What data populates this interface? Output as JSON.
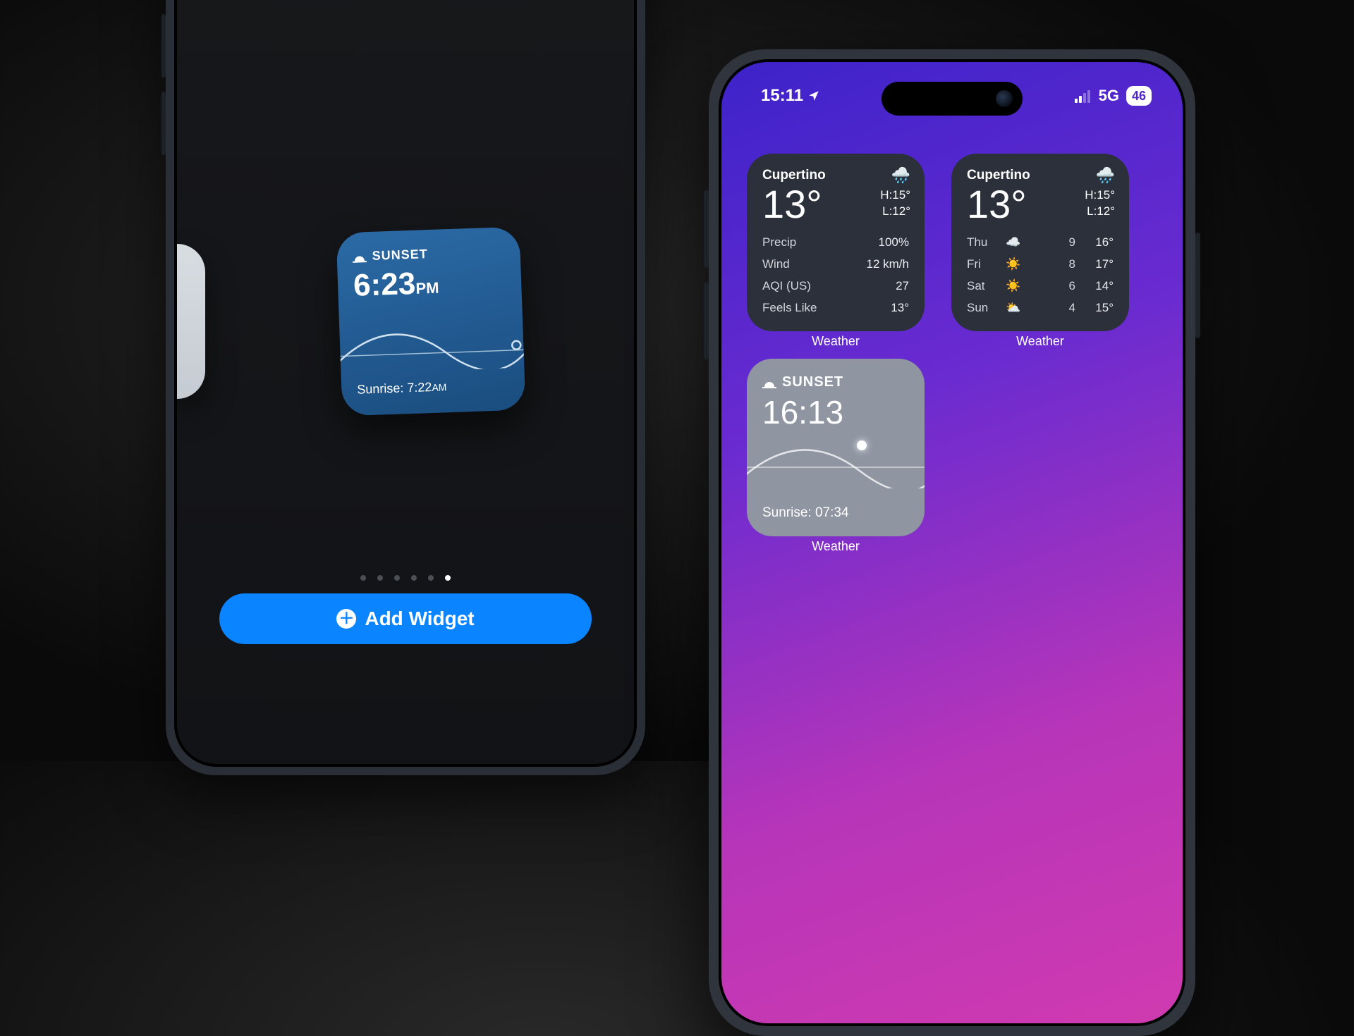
{
  "left": {
    "sunset": {
      "label": "SUNSET",
      "time": "6:23",
      "ampm": "PM",
      "sunrise_label": "Sunrise:",
      "sunrise_time": "7:22",
      "sunrise_ampm": "AM"
    },
    "page_dots": {
      "count": 6,
      "active_index": 5
    },
    "add_button": "Add Widget"
  },
  "right": {
    "status": {
      "time": "15:11",
      "network": "5G",
      "battery": "46"
    },
    "widgets": {
      "detail": {
        "location": "Cupertino",
        "temp": "13°",
        "high": "H:15°",
        "low": "L:12°",
        "rows": [
          {
            "label": "Precip",
            "value": "100%"
          },
          {
            "label": "Wind",
            "value": "12 km/h"
          },
          {
            "label": "AQI (US)",
            "value": "27"
          },
          {
            "label": "Feels Like",
            "value": "13°"
          }
        ],
        "caption": "Weather"
      },
      "forecast": {
        "location": "Cupertino",
        "temp": "13°",
        "high": "H:15°",
        "low": "L:12°",
        "days": [
          {
            "day": "Thu",
            "icon": "☁️",
            "precip": "9",
            "temp": "16°"
          },
          {
            "day": "Fri",
            "icon": "☀️",
            "precip": "8",
            "temp": "17°"
          },
          {
            "day": "Sat",
            "icon": "☀️",
            "precip": "6",
            "temp": "14°"
          },
          {
            "day": "Sun",
            "icon": "⛅",
            "precip": "4",
            "temp": "15°"
          }
        ],
        "caption": "Weather"
      },
      "sunset": {
        "label": "SUNSET",
        "time": "16:13",
        "sunrise_label": "Sunrise:",
        "sunrise_time": "07:34",
        "caption": "Weather"
      }
    }
  }
}
